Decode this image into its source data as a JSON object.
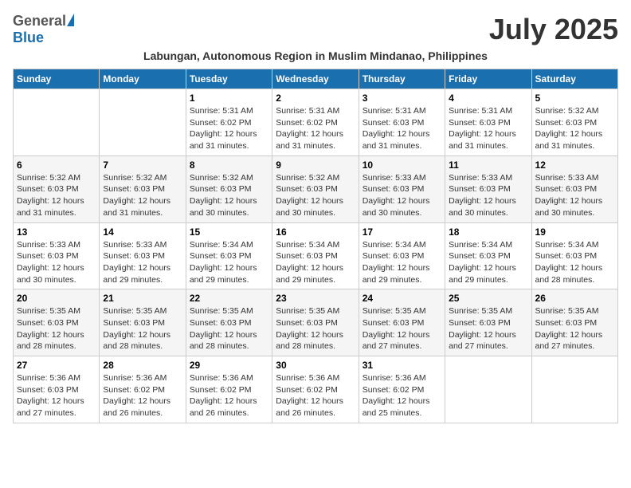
{
  "header": {
    "logo_general": "General",
    "logo_blue": "Blue",
    "month_title": "July 2025",
    "subtitle": "Labungan, Autonomous Region in Muslim Mindanao, Philippines"
  },
  "weekdays": [
    "Sunday",
    "Monday",
    "Tuesday",
    "Wednesday",
    "Thursday",
    "Friday",
    "Saturday"
  ],
  "weeks": [
    [
      {
        "day": "",
        "sunrise": "",
        "sunset": "",
        "daylight": ""
      },
      {
        "day": "",
        "sunrise": "",
        "sunset": "",
        "daylight": ""
      },
      {
        "day": "1",
        "sunrise": "Sunrise: 5:31 AM",
        "sunset": "Sunset: 6:02 PM",
        "daylight": "Daylight: 12 hours and 31 minutes."
      },
      {
        "day": "2",
        "sunrise": "Sunrise: 5:31 AM",
        "sunset": "Sunset: 6:02 PM",
        "daylight": "Daylight: 12 hours and 31 minutes."
      },
      {
        "day": "3",
        "sunrise": "Sunrise: 5:31 AM",
        "sunset": "Sunset: 6:03 PM",
        "daylight": "Daylight: 12 hours and 31 minutes."
      },
      {
        "day": "4",
        "sunrise": "Sunrise: 5:31 AM",
        "sunset": "Sunset: 6:03 PM",
        "daylight": "Daylight: 12 hours and 31 minutes."
      },
      {
        "day": "5",
        "sunrise": "Sunrise: 5:32 AM",
        "sunset": "Sunset: 6:03 PM",
        "daylight": "Daylight: 12 hours and 31 minutes."
      }
    ],
    [
      {
        "day": "6",
        "sunrise": "Sunrise: 5:32 AM",
        "sunset": "Sunset: 6:03 PM",
        "daylight": "Daylight: 12 hours and 31 minutes."
      },
      {
        "day": "7",
        "sunrise": "Sunrise: 5:32 AM",
        "sunset": "Sunset: 6:03 PM",
        "daylight": "Daylight: 12 hours and 31 minutes."
      },
      {
        "day": "8",
        "sunrise": "Sunrise: 5:32 AM",
        "sunset": "Sunset: 6:03 PM",
        "daylight": "Daylight: 12 hours and 30 minutes."
      },
      {
        "day": "9",
        "sunrise": "Sunrise: 5:32 AM",
        "sunset": "Sunset: 6:03 PM",
        "daylight": "Daylight: 12 hours and 30 minutes."
      },
      {
        "day": "10",
        "sunrise": "Sunrise: 5:33 AM",
        "sunset": "Sunset: 6:03 PM",
        "daylight": "Daylight: 12 hours and 30 minutes."
      },
      {
        "day": "11",
        "sunrise": "Sunrise: 5:33 AM",
        "sunset": "Sunset: 6:03 PM",
        "daylight": "Daylight: 12 hours and 30 minutes."
      },
      {
        "day": "12",
        "sunrise": "Sunrise: 5:33 AM",
        "sunset": "Sunset: 6:03 PM",
        "daylight": "Daylight: 12 hours and 30 minutes."
      }
    ],
    [
      {
        "day": "13",
        "sunrise": "Sunrise: 5:33 AM",
        "sunset": "Sunset: 6:03 PM",
        "daylight": "Daylight: 12 hours and 30 minutes."
      },
      {
        "day": "14",
        "sunrise": "Sunrise: 5:33 AM",
        "sunset": "Sunset: 6:03 PM",
        "daylight": "Daylight: 12 hours and 29 minutes."
      },
      {
        "day": "15",
        "sunrise": "Sunrise: 5:34 AM",
        "sunset": "Sunset: 6:03 PM",
        "daylight": "Daylight: 12 hours and 29 minutes."
      },
      {
        "day": "16",
        "sunrise": "Sunrise: 5:34 AM",
        "sunset": "Sunset: 6:03 PM",
        "daylight": "Daylight: 12 hours and 29 minutes."
      },
      {
        "day": "17",
        "sunrise": "Sunrise: 5:34 AM",
        "sunset": "Sunset: 6:03 PM",
        "daylight": "Daylight: 12 hours and 29 minutes."
      },
      {
        "day": "18",
        "sunrise": "Sunrise: 5:34 AM",
        "sunset": "Sunset: 6:03 PM",
        "daylight": "Daylight: 12 hours and 29 minutes."
      },
      {
        "day": "19",
        "sunrise": "Sunrise: 5:34 AM",
        "sunset": "Sunset: 6:03 PM",
        "daylight": "Daylight: 12 hours and 28 minutes."
      }
    ],
    [
      {
        "day": "20",
        "sunrise": "Sunrise: 5:35 AM",
        "sunset": "Sunset: 6:03 PM",
        "daylight": "Daylight: 12 hours and 28 minutes."
      },
      {
        "day": "21",
        "sunrise": "Sunrise: 5:35 AM",
        "sunset": "Sunset: 6:03 PM",
        "daylight": "Daylight: 12 hours and 28 minutes."
      },
      {
        "day": "22",
        "sunrise": "Sunrise: 5:35 AM",
        "sunset": "Sunset: 6:03 PM",
        "daylight": "Daylight: 12 hours and 28 minutes."
      },
      {
        "day": "23",
        "sunrise": "Sunrise: 5:35 AM",
        "sunset": "Sunset: 6:03 PM",
        "daylight": "Daylight: 12 hours and 28 minutes."
      },
      {
        "day": "24",
        "sunrise": "Sunrise: 5:35 AM",
        "sunset": "Sunset: 6:03 PM",
        "daylight": "Daylight: 12 hours and 27 minutes."
      },
      {
        "day": "25",
        "sunrise": "Sunrise: 5:35 AM",
        "sunset": "Sunset: 6:03 PM",
        "daylight": "Daylight: 12 hours and 27 minutes."
      },
      {
        "day": "26",
        "sunrise": "Sunrise: 5:35 AM",
        "sunset": "Sunset: 6:03 PM",
        "daylight": "Daylight: 12 hours and 27 minutes."
      }
    ],
    [
      {
        "day": "27",
        "sunrise": "Sunrise: 5:36 AM",
        "sunset": "Sunset: 6:03 PM",
        "daylight": "Daylight: 12 hours and 27 minutes."
      },
      {
        "day": "28",
        "sunrise": "Sunrise: 5:36 AM",
        "sunset": "Sunset: 6:02 PM",
        "daylight": "Daylight: 12 hours and 26 minutes."
      },
      {
        "day": "29",
        "sunrise": "Sunrise: 5:36 AM",
        "sunset": "Sunset: 6:02 PM",
        "daylight": "Daylight: 12 hours and 26 minutes."
      },
      {
        "day": "30",
        "sunrise": "Sunrise: 5:36 AM",
        "sunset": "Sunset: 6:02 PM",
        "daylight": "Daylight: 12 hours and 26 minutes."
      },
      {
        "day": "31",
        "sunrise": "Sunrise: 5:36 AM",
        "sunset": "Sunset: 6:02 PM",
        "daylight": "Daylight: 12 hours and 25 minutes."
      },
      {
        "day": "",
        "sunrise": "",
        "sunset": "",
        "daylight": ""
      },
      {
        "day": "",
        "sunrise": "",
        "sunset": "",
        "daylight": ""
      }
    ]
  ]
}
